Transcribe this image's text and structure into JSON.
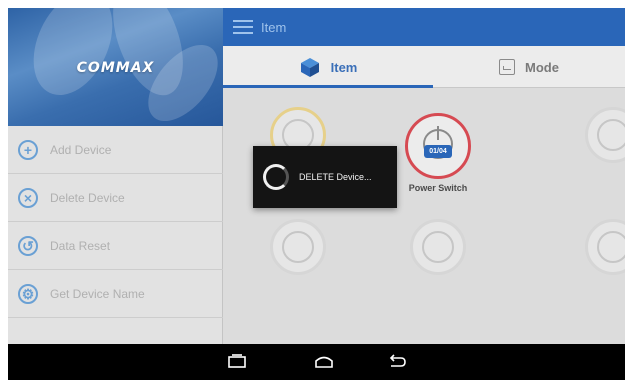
{
  "sidebar": {
    "brand": "COMMAX",
    "items": [
      {
        "label": "Add Device",
        "icon": "plus-circle-icon"
      },
      {
        "label": "Delete Device",
        "icon": "x-circle-icon"
      },
      {
        "label": "Data Reset",
        "icon": "reset-icon"
      },
      {
        "label": "Get Device Name",
        "icon": "settings-icon"
      }
    ]
  },
  "appbar": {
    "title": "Item"
  },
  "tabs": [
    {
      "label": "Item",
      "icon": "cube-icon",
      "active": true
    },
    {
      "label": "Mode",
      "icon": "mode-icon",
      "active": false
    }
  ],
  "devices": {
    "power_switch": {
      "name": "Power Switch",
      "badge": "01/04"
    }
  },
  "dialog": {
    "message": "DELETE Device..."
  },
  "navbar": {
    "buttons": [
      "back-icon",
      "home-icon",
      "recent-apps-icon"
    ]
  },
  "colors": {
    "accent": "#2a66b8",
    "sidebar_icon": "#6aa0d4",
    "power_ring": "#d64a52"
  }
}
